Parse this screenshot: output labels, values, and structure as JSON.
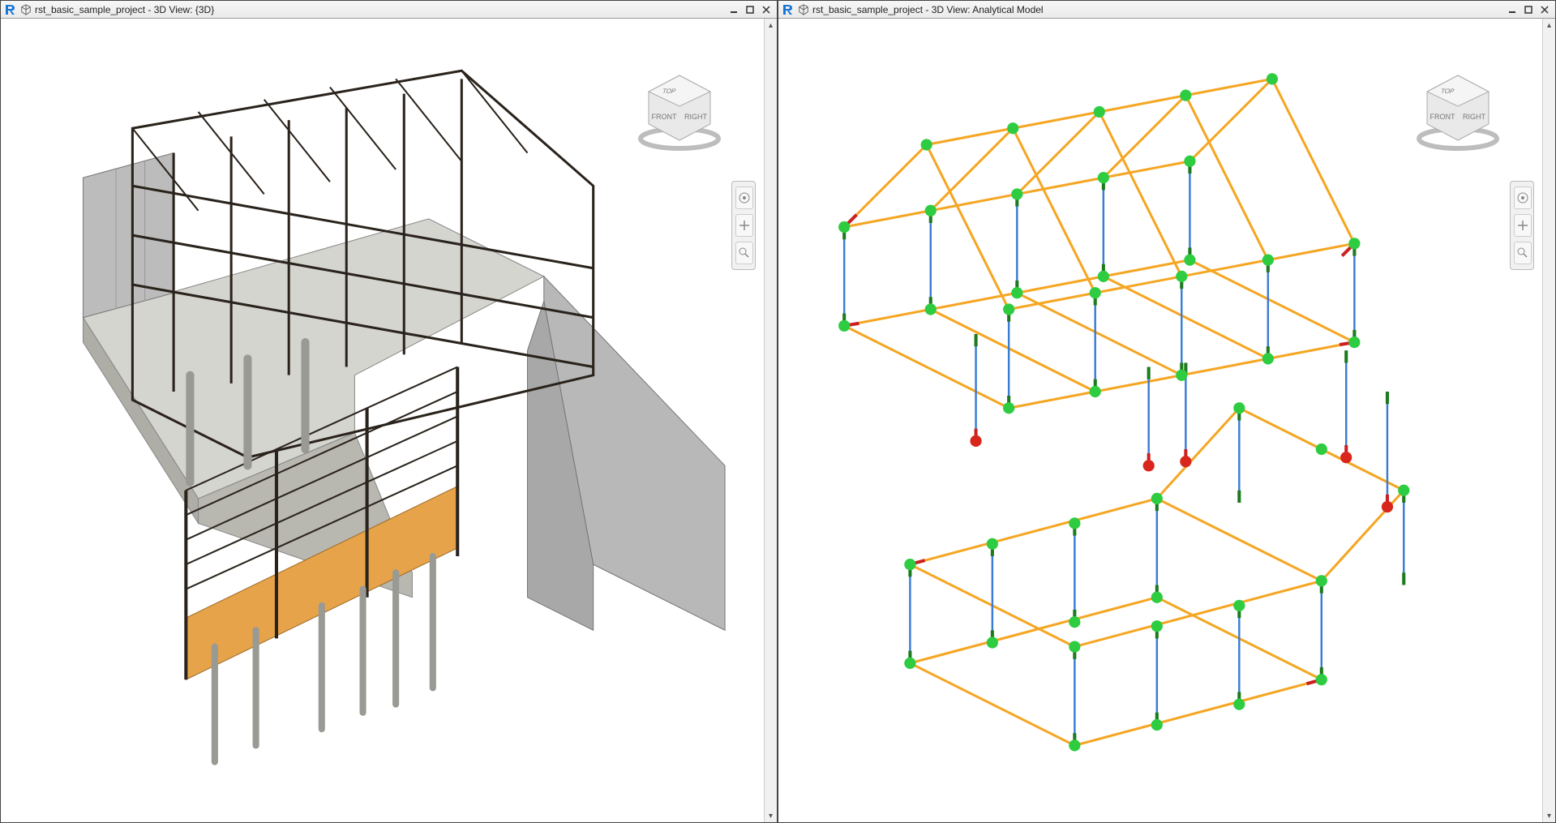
{
  "panes": {
    "left": {
      "title": "rst_basic_sample_project - 3D View: {3D}",
      "viewcube": {
        "top": "TOP",
        "front": "FRONT",
        "right": "RIGHT"
      }
    },
    "right": {
      "title": "rst_basic_sample_project - 3D View: Analytical Model",
      "viewcube": {
        "top": "TOP",
        "front": "FRONT",
        "right": "RIGHT"
      }
    }
  },
  "colors": {
    "beam": "#f5a623",
    "column": "#3a7bd5",
    "release": "#cc2020",
    "fixity": "#1d7a1d",
    "node": "#2ecc40",
    "support": "#d8261c",
    "panel": "#bdbdbd",
    "steel": "#2a231c",
    "concrete": "#c8c8c2",
    "wood": "#e6a34a"
  },
  "navTools": [
    "wheel",
    "pan",
    "zoom"
  ]
}
